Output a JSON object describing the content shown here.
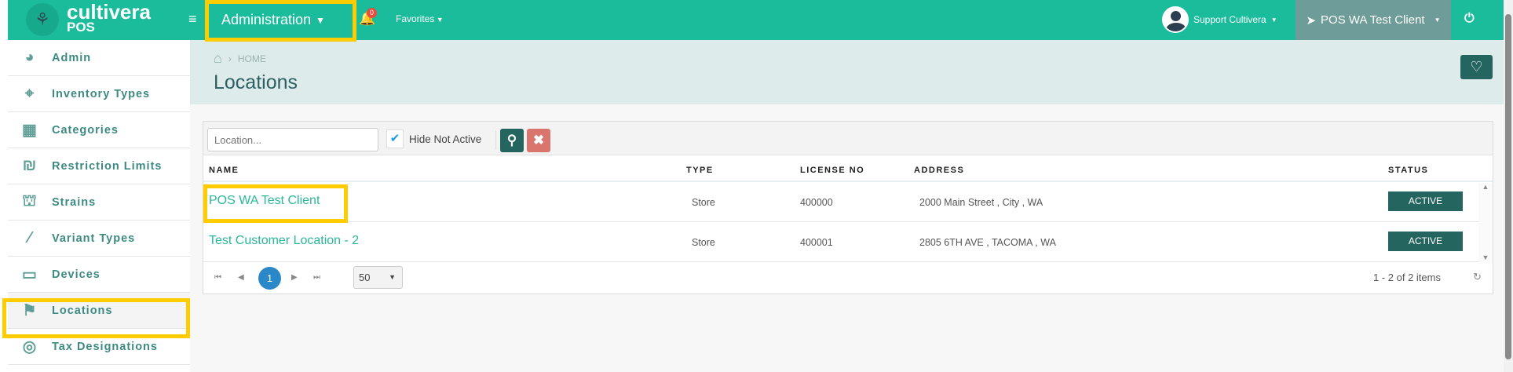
{
  "header": {
    "logo_main": "cultivera",
    "logo_sub": "POS",
    "menu": "Administration",
    "notifications": "0",
    "favorites": "Favorites",
    "user": "Support Cultivera",
    "client": "POS WA Test Client"
  },
  "sidebar": {
    "items": [
      {
        "label": "Admin",
        "icon": "dashboard-icon"
      },
      {
        "label": "Inventory Types",
        "icon": "crosshair-icon"
      },
      {
        "label": "Categories",
        "icon": "grid-icon"
      },
      {
        "label": "Restriction Limits",
        "icon": "shekel-icon"
      },
      {
        "label": "Strains",
        "icon": "sitemap-icon"
      },
      {
        "label": "Variant Types",
        "icon": "magic-wand-icon"
      },
      {
        "label": "Devices",
        "icon": "monitor-icon"
      },
      {
        "label": "Locations",
        "icon": "signpost-icon",
        "active": true
      },
      {
        "label": "Tax Designations",
        "icon": "bullseye-icon"
      }
    ]
  },
  "page": {
    "breadcrumb": "HOME",
    "title": "Locations"
  },
  "toolbar": {
    "search_placeholder": "Location...",
    "hide_not_active": "Hide Not Active",
    "hide_checked": true
  },
  "table": {
    "columns": [
      "NAME",
      "TYPE",
      "LICENSE NO",
      "ADDRESS",
      "STATUS"
    ],
    "rows": [
      {
        "name": "POS WA Test Client",
        "type": "Store",
        "license": "400000",
        "address": "2000 Main Street , City , WA",
        "status": "ACTIVE"
      },
      {
        "name": "Test Customer Location - 2",
        "type": "Store",
        "license": "400001",
        "address": "2805 6TH AVE , TACOMA , WA",
        "status": "ACTIVE"
      }
    ]
  },
  "pager": {
    "current": "1",
    "page_size": "50",
    "summary": "1 - 2 of 2 items"
  },
  "colors": {
    "primary": "#1abc9c",
    "dark": "#25655f",
    "highlight": "#ffcc00"
  }
}
